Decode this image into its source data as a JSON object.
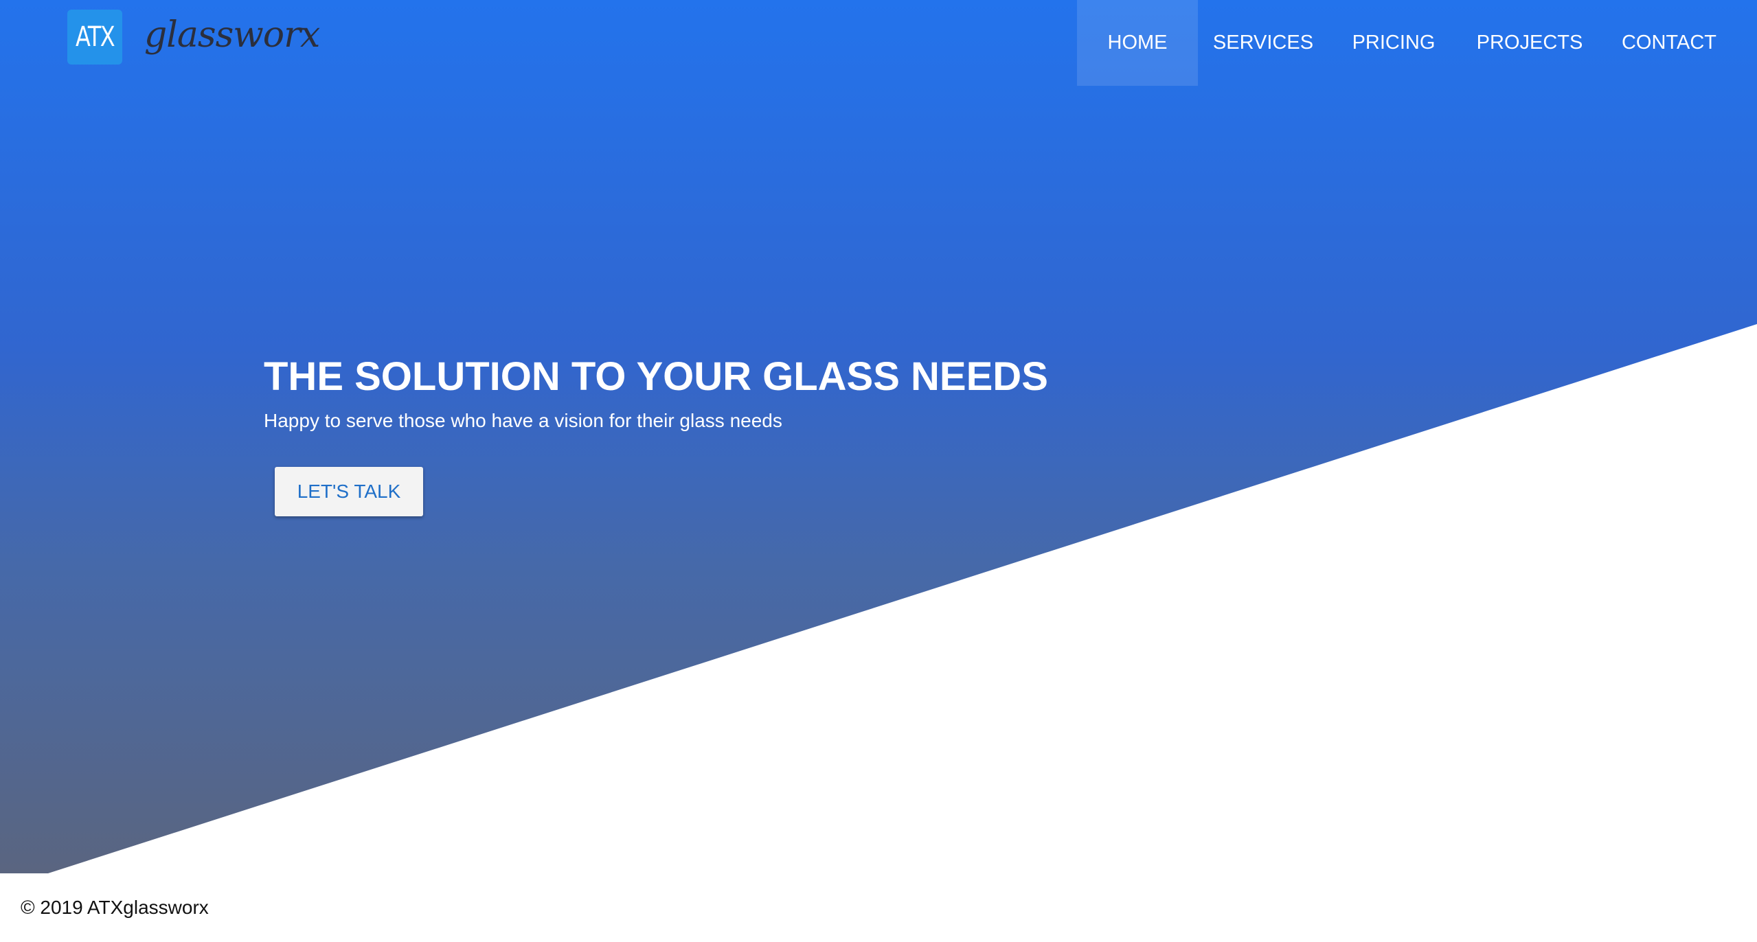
{
  "brand": {
    "logo_text": "ATX",
    "wordmark": "glassworx",
    "logo_color": "#2492ea"
  },
  "nav": {
    "items": [
      {
        "label": "HOME",
        "active": true
      },
      {
        "label": "SERVICES",
        "active": false
      },
      {
        "label": "PRICING",
        "active": false
      },
      {
        "label": "PROJECTS",
        "active": false
      },
      {
        "label": "CONTACT",
        "active": false
      }
    ]
  },
  "hero": {
    "title": "THE SOLUTION TO YOUR GLASS NEEDS",
    "subtitle": "Happy to serve those who have a vision for their glass needs",
    "cta_label": "LET'S TALK",
    "gradient_top": "#2373ec",
    "gradient_bottom": "#5a6580"
  },
  "footer": {
    "copyright": "© 2019 ATXglassworx"
  }
}
